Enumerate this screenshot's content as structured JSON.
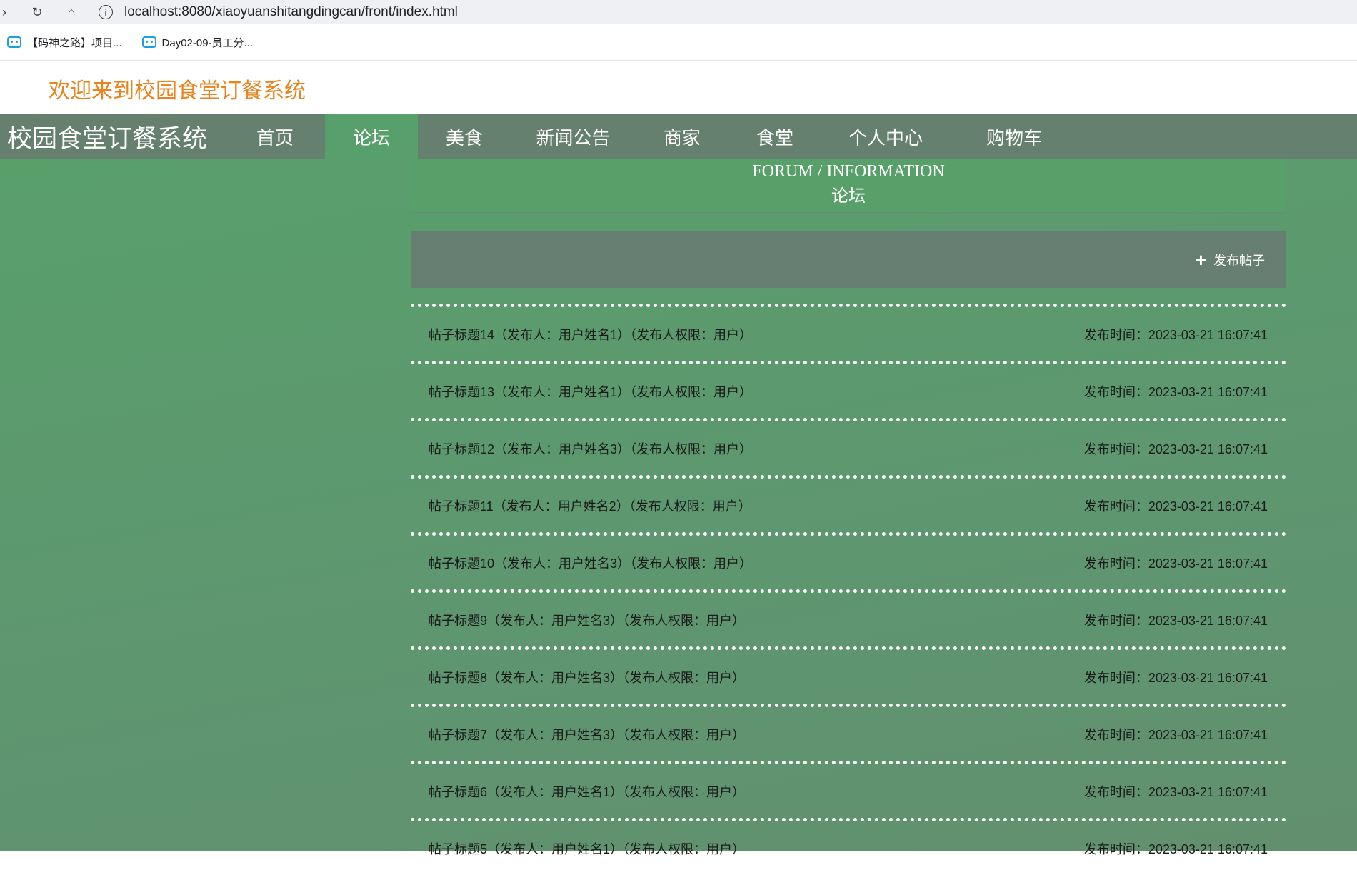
{
  "browser": {
    "url": "localhost:8080/xiaoyuanshitangdingcan/front/index.html",
    "bookmarks": [
      "【码神之路】项目...",
      "Day02-09-员工分..."
    ]
  },
  "welcome_text": "欢迎来到校园食堂订餐系统",
  "nav": {
    "site_title": "校园食堂订餐系统",
    "items": [
      "首页",
      "论坛",
      "美食",
      "新闻公告",
      "商家",
      "食堂",
      "个人中心",
      "购物车"
    ],
    "active": "论坛"
  },
  "section": {
    "title_en": "FORUM / INFORMATION",
    "title_cn": "论坛"
  },
  "actions": {
    "publish_label": "发布帖子"
  },
  "posts": [
    {
      "title": "帖子标题14（发布人：用户姓名1）（发布人权限：用户）",
      "time": "发布时间：2023-03-21 16:07:41"
    },
    {
      "title": "帖子标题13（发布人：用户姓名1）（发布人权限：用户）",
      "time": "发布时间：2023-03-21 16:07:41"
    },
    {
      "title": "帖子标题12（发布人：用户姓名3）（发布人权限：用户）",
      "time": "发布时间：2023-03-21 16:07:41"
    },
    {
      "title": "帖子标题11（发布人：用户姓名2）（发布人权限：用户）",
      "time": "发布时间：2023-03-21 16:07:41"
    },
    {
      "title": "帖子标题10（发布人：用户姓名3）（发布人权限：用户）",
      "time": "发布时间：2023-03-21 16:07:41"
    },
    {
      "title": "帖子标题9（发布人：用户姓名3）（发布人权限：用户）",
      "time": "发布时间：2023-03-21 16:07:41"
    },
    {
      "title": "帖子标题8（发布人：用户姓名3）（发布人权限：用户）",
      "time": "发布时间：2023-03-21 16:07:41"
    },
    {
      "title": "帖子标题7（发布人：用户姓名3）（发布人权限：用户）",
      "time": "发布时间：2023-03-21 16:07:41"
    },
    {
      "title": "帖子标题6（发布人：用户姓名1）（发布人权限：用户）",
      "time": "发布时间：2023-03-21 16:07:41"
    },
    {
      "title": "帖子标题5（发布人：用户姓名1）（发布人权限：用户）",
      "time": "发布时间：2023-03-21 16:07:41"
    }
  ]
}
